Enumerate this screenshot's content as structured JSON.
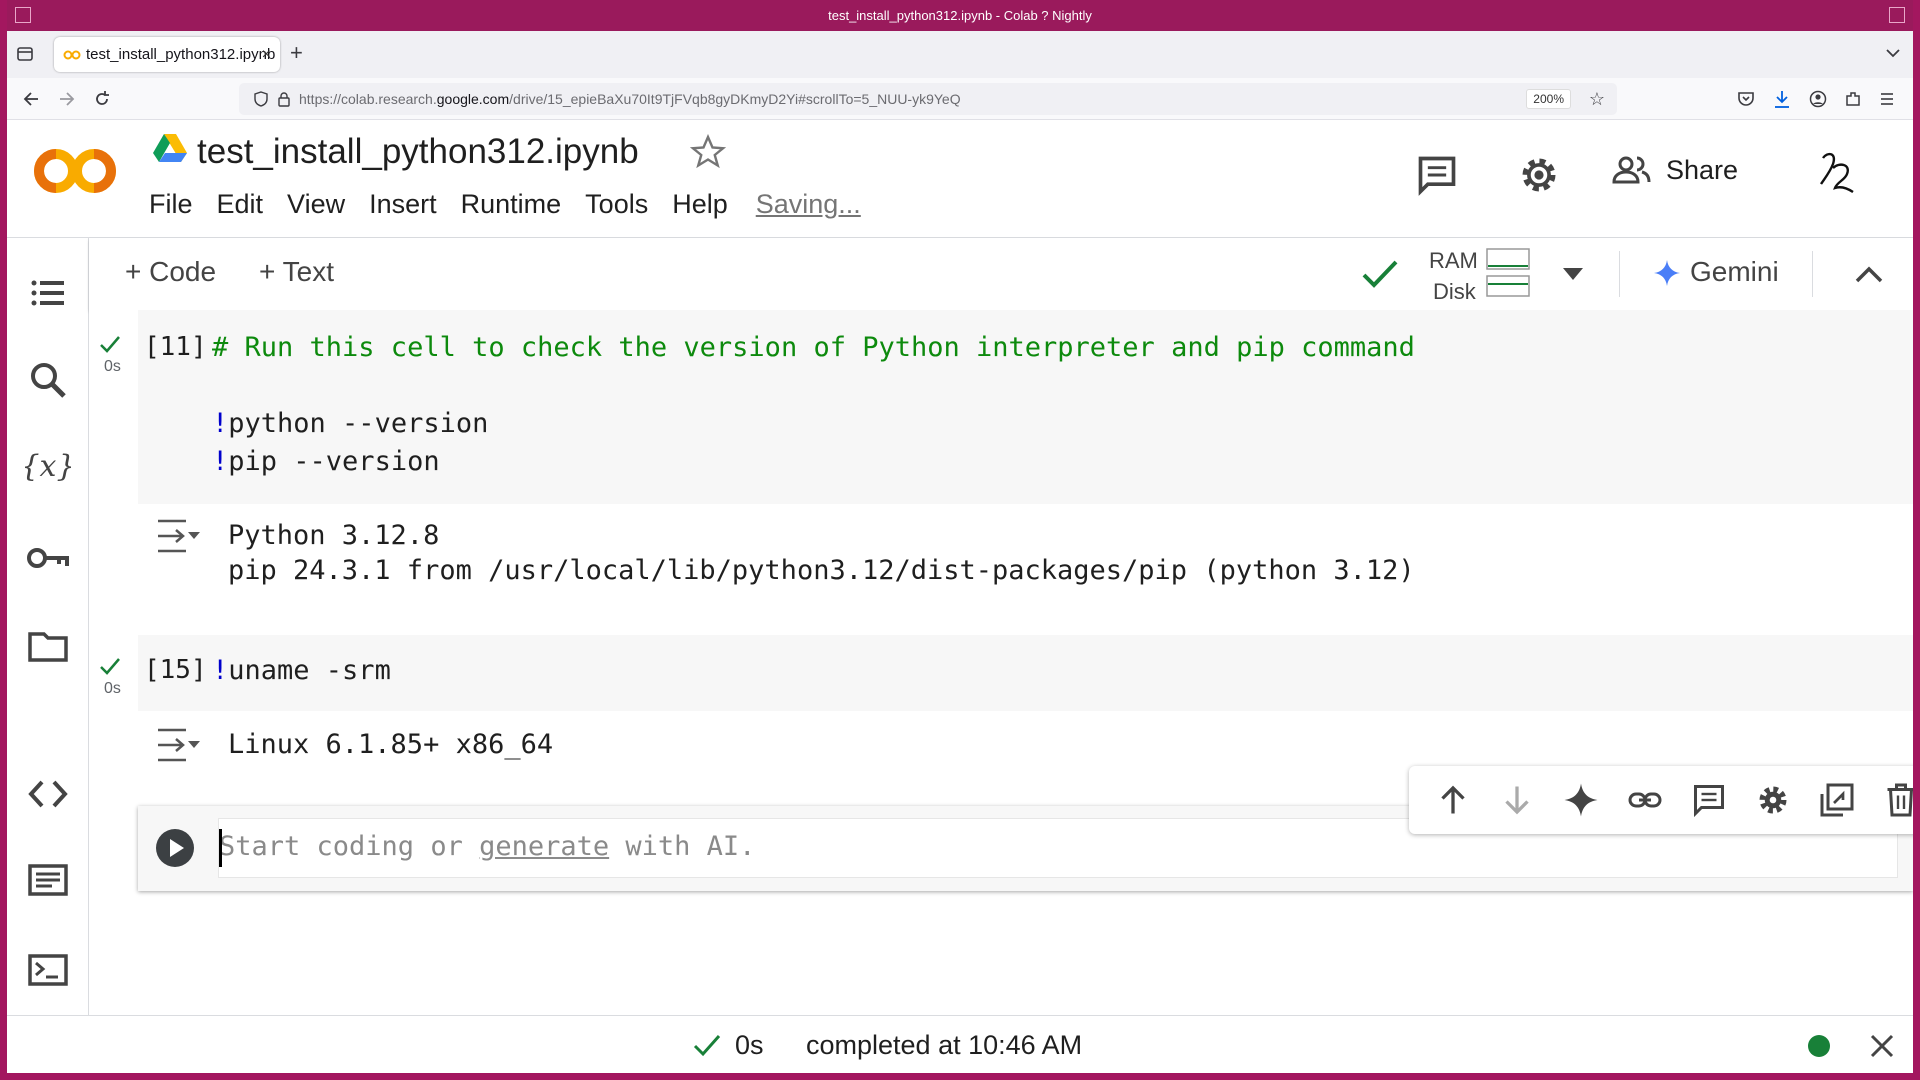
{
  "window": {
    "title": "test_install_python312.ipynb - Colab ? Nightly"
  },
  "browser": {
    "tab_title": "test_install_python312.ipynb",
    "url_prefix": "https://colab.research.",
    "url_domain": "google.com",
    "url_suffix": "/drive/15_epieBaXu70It9TjFVqb8gyDKmyD2Yi#scrollTo=5_NUU-yk9YeQ",
    "zoom": "200%",
    "new_tab": "+"
  },
  "header": {
    "notebook_title": "test_install_python312.ipynb",
    "menu": [
      "File",
      "Edit",
      "View",
      "Insert",
      "Runtime",
      "Tools",
      "Help"
    ],
    "saving": "Saving...",
    "share_label": "Share"
  },
  "toolbar": {
    "add_code": "+ Code",
    "add_text": "+ Text",
    "ram_label": "RAM",
    "disk_label": "Disk",
    "gemini_label": "Gemini"
  },
  "cells": [
    {
      "exec_count": "[11]",
      "duration": "0s",
      "comment": "# Run this cell to check the version of Python interpreter and pip command",
      "lines": [
        {
          "bang": "!",
          "cmd": "python --version"
        },
        {
          "bang": "!",
          "cmd": "pip --version"
        }
      ],
      "output": [
        "Python 3.12.8",
        "pip 24.3.1 from /usr/local/lib/python3.12/dist-packages/pip (python 3.12)"
      ]
    },
    {
      "exec_count": "[15]",
      "duration": "0s",
      "lines": [
        {
          "bang": "!",
          "cmd": "uname -srm"
        }
      ],
      "output": [
        "Linux 6.1.85+ x86_64"
      ]
    }
  ],
  "new_cell": {
    "placeholder_start": "Start coding or ",
    "placeholder_link": "generate",
    "placeholder_end": " with AI."
  },
  "status": {
    "duration": "0s",
    "message": "completed at 10:46 AM"
  },
  "colors": {
    "accent_orange": "#f9ab00",
    "success_green": "#188038",
    "comment_green": "#0d8a0d",
    "frame": "#a3175f"
  }
}
